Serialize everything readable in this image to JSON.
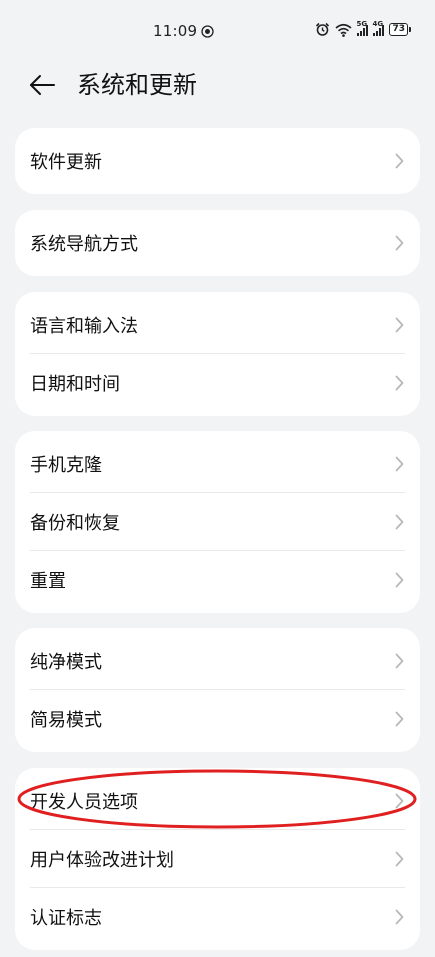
{
  "status_bar": {
    "time": "11:09",
    "battery": "73",
    "signal1_tag": "5G",
    "signal2_tag": "4G"
  },
  "header": {
    "title": "系统和更新"
  },
  "groups": [
    {
      "items": [
        "软件更新"
      ]
    },
    {
      "items": [
        "系统导航方式"
      ]
    },
    {
      "items": [
        "语言和输入法",
        "日期和时间"
      ]
    },
    {
      "items": [
        "手机克隆",
        "备份和恢复",
        "重置"
      ]
    },
    {
      "items": [
        "纯净模式",
        "简易模式"
      ]
    },
    {
      "items": [
        "开发人员选项",
        "用户体验改进计划",
        "认证标志"
      ]
    }
  ],
  "annotation": {
    "highlight_color": "#e02020",
    "highlighted_item": "开发人员选项"
  },
  "colors": {
    "background": "#f1f3f5",
    "card": "#ffffff",
    "chevron": "#b8b8b8"
  }
}
